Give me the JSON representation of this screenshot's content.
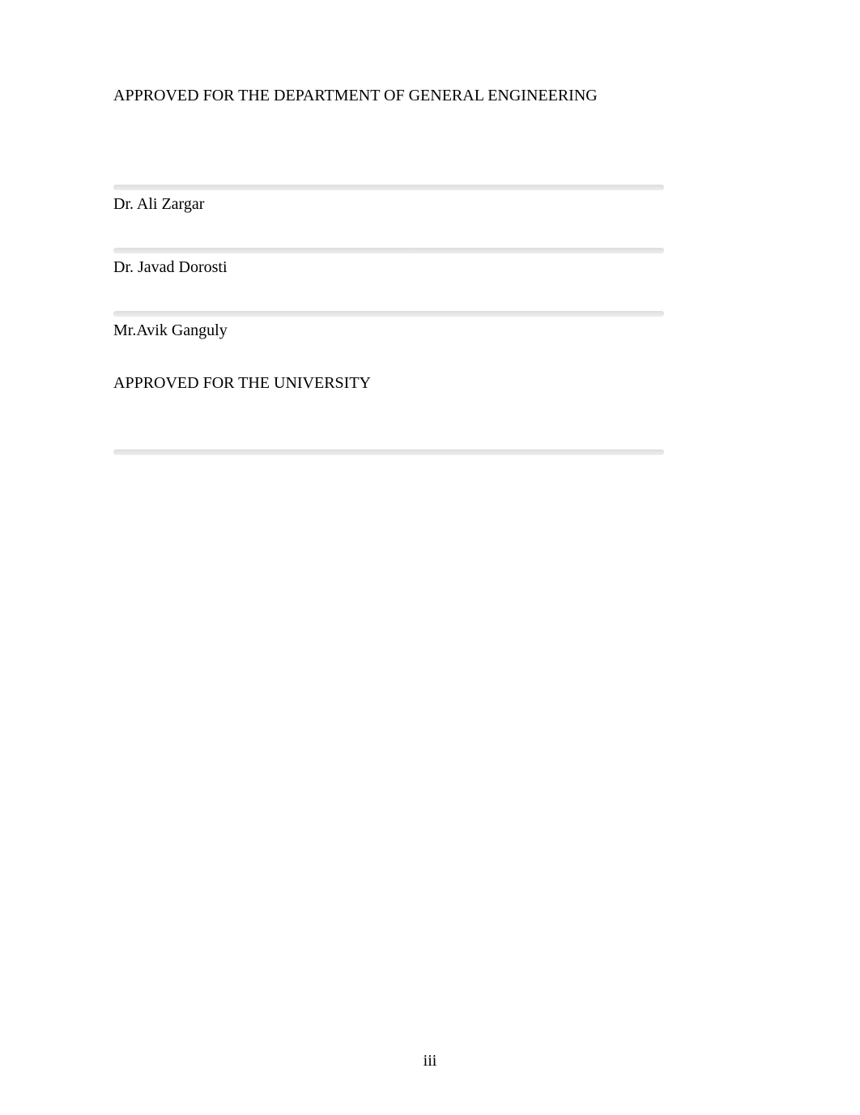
{
  "headings": {
    "department": "APPROVED FOR THE DEPARTMENT OF GENERAL ENGINEERING",
    "university": "APPROVED FOR THE UNIVERSITY"
  },
  "signatures": {
    "s1": "Dr. Ali Zargar",
    "s2": "Dr. Javad Dorosti",
    "s3": "Mr.Avik Ganguly"
  },
  "page_number": "iii"
}
